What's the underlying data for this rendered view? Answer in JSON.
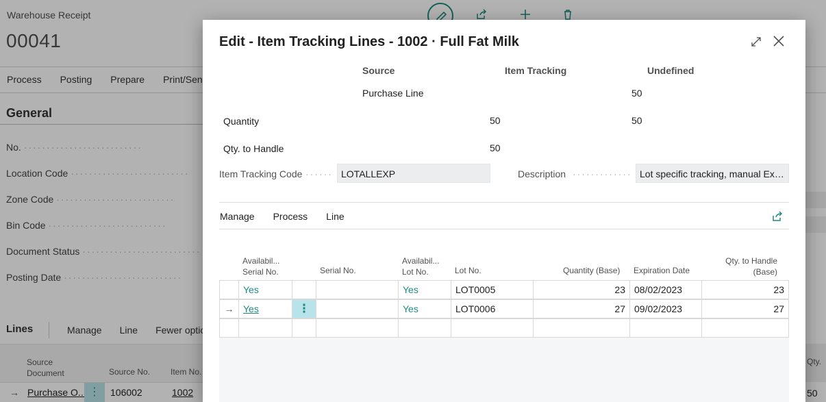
{
  "background": {
    "caption": "Warehouse Receipt",
    "doc_no": "00041",
    "menu": [
      "Process",
      "Posting",
      "Prepare",
      "Print/Send"
    ],
    "section": "General",
    "fields": [
      "No.",
      "Location Code",
      "Zone Code",
      "Bin Code",
      "Document Status",
      "Posting Date"
    ],
    "lines_title": "Lines",
    "lines_menu": [
      "Manage",
      "Line",
      "Fewer options"
    ],
    "grid_headers": {
      "source_document": "Source Document",
      "source_no": "Source No.",
      "item_no": "Item No."
    },
    "grid_row": {
      "source_document": "Purchase O...",
      "source_no": "106002",
      "item_no": "1002"
    },
    "right_header": "Qty. to Receiving",
    "right_value": "50"
  },
  "dialog": {
    "title": "Edit - Item Tracking Lines - 1002 · Full Fat Milk",
    "summary": {
      "headers": [
        "Source",
        "Item Tracking",
        "Undefined"
      ],
      "source_type": "Purchase Line",
      "source_type_undefined": "50",
      "rows": [
        {
          "label": "Quantity",
          "source": "50",
          "undefined": "50"
        },
        {
          "label": "Qty. to Handle",
          "source": "50",
          "undefined": ""
        }
      ]
    },
    "item_tracking_code_label": "Item Tracking Code",
    "item_tracking_code": "LOTALLEXP",
    "description_label": "Description",
    "description": "Lot specific tracking, manual Exp...",
    "actions": [
      "Manage",
      "Process",
      "Line"
    ],
    "grid": {
      "headers": {
        "avail_serial": [
          "Availabil...",
          "Serial No."
        ],
        "serial_no": "Serial No.",
        "avail_lot": [
          "Availabil...",
          "Lot No."
        ],
        "lot_no": "Lot No.",
        "quantity_base": "Quantity (Base)",
        "expiration_date": "Expiration Date",
        "qty_to_handle": [
          "Qty. to Handle",
          "(Base)"
        ]
      },
      "rows": [
        {
          "avail_serial": "Yes",
          "serial_no": "",
          "avail_lot": "Yes",
          "lot_no": "LOT0005",
          "quantity_base": "23",
          "expiration_date": "08/02/2023",
          "qty_to_handle": "23"
        },
        {
          "avail_serial": "Yes",
          "serial_no": "",
          "avail_lot": "Yes",
          "lot_no": "LOT0006",
          "quantity_base": "27",
          "expiration_date": "09/02/2023",
          "qty_to_handle": "27"
        }
      ],
      "row_menu_glyph": "⋮",
      "current_row_glyph": "→"
    }
  },
  "icons": [
    "edit-icon",
    "share-icon",
    "add-icon",
    "delete-icon",
    "expand-icon",
    "close-icon"
  ],
  "colors": {
    "accent": "#1e8c7e",
    "selected_cell": "#b9e3ea"
  }
}
